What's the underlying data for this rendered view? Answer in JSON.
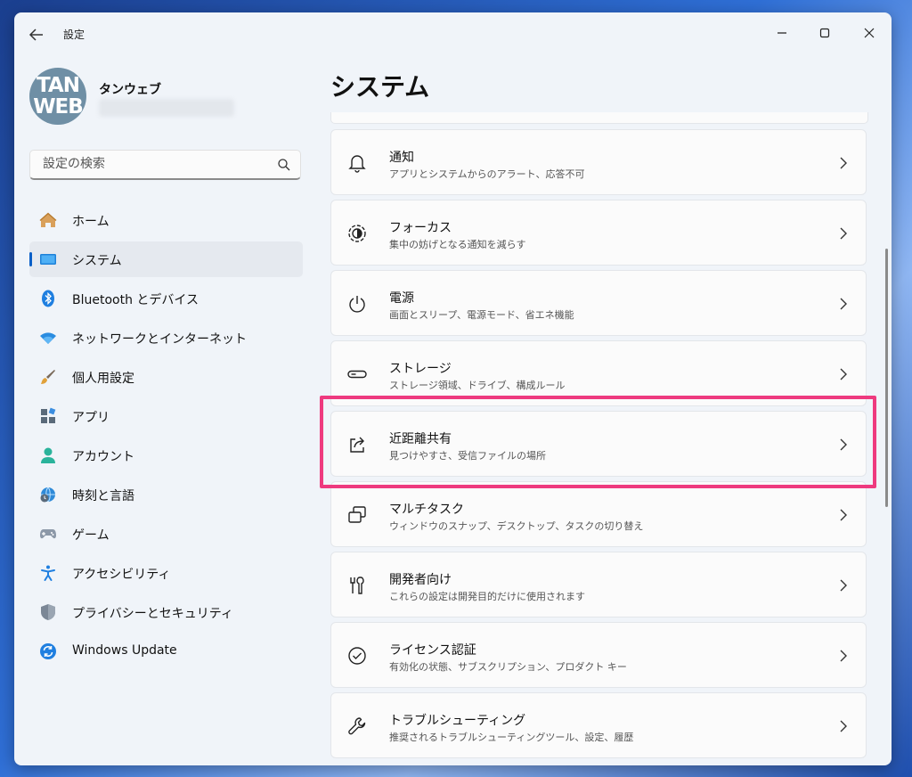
{
  "window": {
    "title": "設定"
  },
  "profile": {
    "avatar_line1": "TAN",
    "avatar_line2": "WEB",
    "name": "タンウェブ"
  },
  "search": {
    "placeholder": "設定の検索"
  },
  "nav": {
    "items": [
      {
        "label": "ホーム",
        "icon": "home-icon"
      },
      {
        "label": "システム",
        "icon": "system-display-icon",
        "selected": true
      },
      {
        "label": "Bluetooth とデバイス",
        "icon": "bluetooth-icon"
      },
      {
        "label": "ネットワークとインターネット",
        "icon": "wifi-icon"
      },
      {
        "label": "個人用設定",
        "icon": "paint-brush-icon"
      },
      {
        "label": "アプリ",
        "icon": "apps-icon"
      },
      {
        "label": "アカウント",
        "icon": "account-icon"
      },
      {
        "label": "時刻と言語",
        "icon": "time-language-icon"
      },
      {
        "label": "ゲーム",
        "icon": "gamepad-icon"
      },
      {
        "label": "アクセシビリティ",
        "icon": "accessibility-icon"
      },
      {
        "label": "プライバシーとセキュリティ",
        "icon": "shield-icon"
      },
      {
        "label": "Windows Update",
        "icon": "windows-update-icon"
      }
    ]
  },
  "page": {
    "title": "システム"
  },
  "settings": [
    {
      "title": "通知",
      "desc": "アプリとシステムからのアラート、応答不可",
      "icon": "bell-icon"
    },
    {
      "title": "フォーカス",
      "desc": "集中の妨げとなる通知を減らす",
      "icon": "focus-icon"
    },
    {
      "title": "電源",
      "desc": "画面とスリープ、電源モード、省エネ機能",
      "icon": "power-icon"
    },
    {
      "title": "ストレージ",
      "desc": "ストレージ領域、ドライブ、構成ルール",
      "icon": "storage-icon"
    },
    {
      "title": "近距離共有",
      "desc": "見つけやすさ、受信ファイルの場所",
      "icon": "share-icon"
    },
    {
      "title": "マルチタスク",
      "desc": "ウィンドウのスナップ、デスクトップ、タスクの切り替え",
      "icon": "multitask-icon"
    },
    {
      "title": "開発者向け",
      "desc": "これらの設定は開発目的だけに使用されます",
      "icon": "developer-tools-icon"
    },
    {
      "title": "ライセンス認証",
      "desc": "有効化の状態、サブスクリプション、プロダクト キー",
      "icon": "activation-check-icon"
    },
    {
      "title": "トラブルシューティング",
      "desc": "推奨されるトラブルシューティングツール、設定、履歴",
      "icon": "wrench-icon"
    }
  ],
  "colors": {
    "accent": "#0a5fc7",
    "highlight": "#ee3a7f"
  }
}
